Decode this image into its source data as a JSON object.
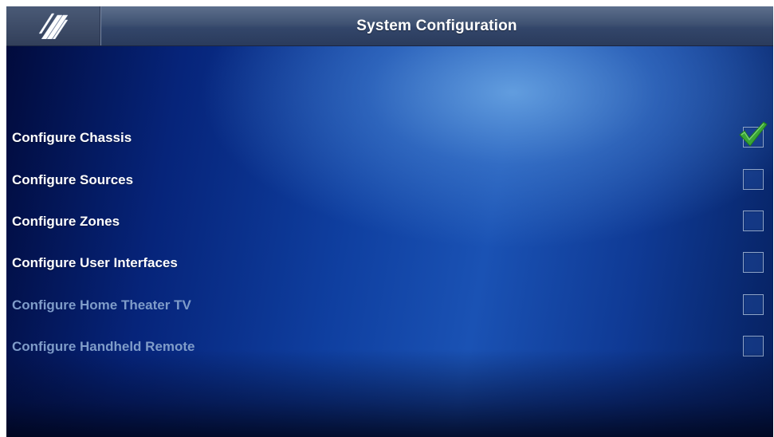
{
  "header": {
    "title": "System Configuration",
    "logo_icon": "brand-stripes-logo"
  },
  "menu": {
    "items": [
      {
        "label": "Configure Chassis",
        "checked": true,
        "enabled": true
      },
      {
        "label": "Configure Sources",
        "checked": false,
        "enabled": true
      },
      {
        "label": "Configure Zones",
        "checked": false,
        "enabled": true
      },
      {
        "label": "Configure User Interfaces",
        "checked": false,
        "enabled": true
      },
      {
        "label": "Configure Home Theater TV",
        "checked": false,
        "enabled": false
      },
      {
        "label": "Configure Handheld Remote",
        "checked": false,
        "enabled": false
      }
    ]
  },
  "colors": {
    "checkmark": "#3aa635",
    "disabled_text": "#7f9cc9",
    "header_bg": "#3f5272"
  }
}
